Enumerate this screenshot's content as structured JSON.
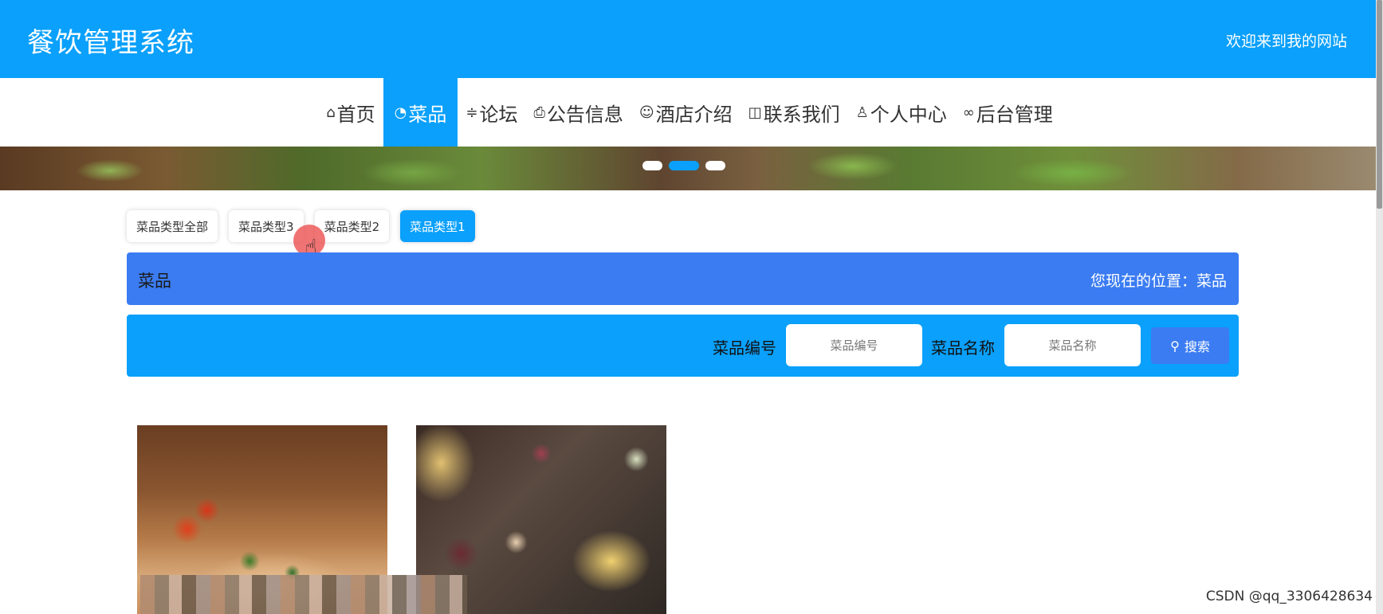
{
  "header": {
    "title": "餐饮管理系统",
    "welcome": "欢迎来到我的网站",
    "bg_color": "#0aa0fb"
  },
  "nav": {
    "items": [
      {
        "label": "首页",
        "icon": "home-icon"
      },
      {
        "label": "菜品",
        "icon": "dashboard-icon",
        "active": true
      },
      {
        "label": "论坛",
        "icon": "sliders-icon"
      },
      {
        "label": "公告信息",
        "icon": "printer-icon"
      },
      {
        "label": "酒店介绍",
        "icon": "face-icon"
      },
      {
        "label": "联系我们",
        "icon": "contact-icon"
      },
      {
        "label": "个人中心",
        "icon": "user-icon"
      },
      {
        "label": "后台管理",
        "icon": "link-icon"
      }
    ]
  },
  "categories": {
    "items": [
      "菜品类型全部",
      "菜品类型3",
      "菜品类型2",
      "菜品类型1"
    ],
    "active_index": 3
  },
  "title_bar": {
    "title": "菜品",
    "location": "您现在的位置：菜品",
    "color": "#3b7cf2"
  },
  "search": {
    "label_id": "菜品编号",
    "placeholder_id": "菜品编号",
    "label_name": "菜品名称",
    "placeholder_name": "菜品名称",
    "button_label": "搜索"
  },
  "watermark": "CSDN @qq_3306428634"
}
